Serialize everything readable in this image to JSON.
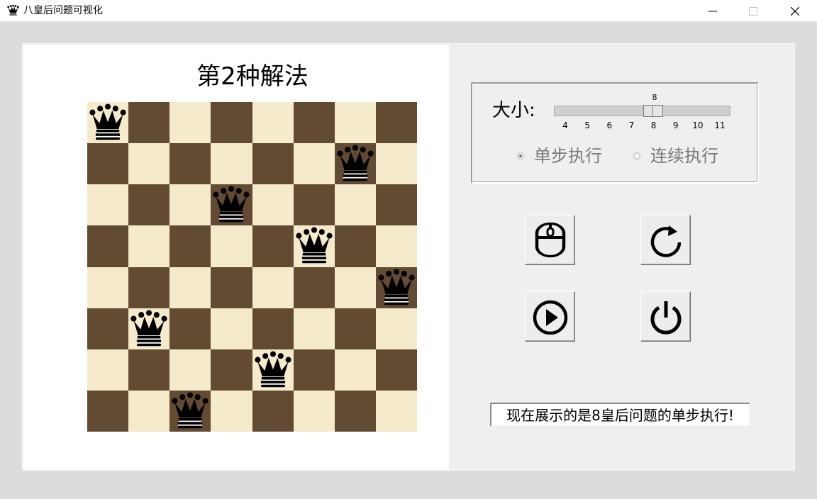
{
  "window": {
    "title": "八皇后问题可视化",
    "app_icon": "queen-icon"
  },
  "board": {
    "title": "第2种解法",
    "size": 8,
    "colors": {
      "light": "#f5ebcc",
      "dark": "#634a33"
    },
    "queen_columns_by_row": [
      0,
      6,
      3,
      5,
      7,
      1,
      4,
      2
    ]
  },
  "controls": {
    "size_label": "大小:",
    "slider": {
      "value": "8",
      "min": 4,
      "max": 11,
      "ticks": [
        "4",
        "5",
        "6",
        "7",
        "8",
        "9",
        "10",
        "11"
      ]
    },
    "modes": [
      {
        "label": "单步执行",
        "checked": true
      },
      {
        "label": "连续执行",
        "checked": false
      }
    ],
    "buttons": [
      {
        "name": "mouse-step-button",
        "icon": "mouse-icon"
      },
      {
        "name": "reset-button",
        "icon": "refresh-icon"
      },
      {
        "name": "play-button",
        "icon": "play-icon"
      },
      {
        "name": "power-button",
        "icon": "power-icon"
      }
    ]
  },
  "status": {
    "text": "现在展示的是8皇后问题的单步执行!"
  }
}
